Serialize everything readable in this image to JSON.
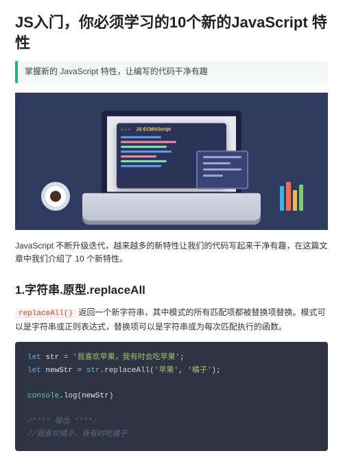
{
  "title": "JS入门，你必须学习的10个新的JavaScript 特性",
  "callout": "掌握新的 JavaScript 特性，让编写的代码干净有趣",
  "hero": {
    "window_title": "JS ECMAScript"
  },
  "intro": "JavaScript 不断升级迭代，越来越多的新特性让我们的代码写起来干净有趣，在这篇文章中我们介绍了 10 个新特性。",
  "section1": {
    "heading": "1.字符串.原型.replaceAll",
    "method_code": "replaceAll()",
    "desc_tail": " 返回一个新字符串，其中模式的所有匹配项都被替换项替换。模式可以是字符串或正则表达式，替换项可以是字符串或为每次匹配执行的函数。",
    "code": {
      "let1": "let",
      "var_str": "str",
      "str_literal": "'我喜欢苹果，我有时会吃苹果'",
      "let2": "let",
      "var_newstr": "newStr",
      "eq": " = ",
      "chain_obj": "str",
      "chain_fn": ".replaceAll(",
      "arg1": "'苹果'",
      "comma": ", ",
      "arg2": "'橘子'",
      "close": ");",
      "console": "console",
      "log": ".log(",
      "log_arg": "newStr",
      "log_close": ")",
      "comment1": "/**** 输出 ****/",
      "comment2": "//我喜欢橘子，我有时吃橘子"
    }
  }
}
